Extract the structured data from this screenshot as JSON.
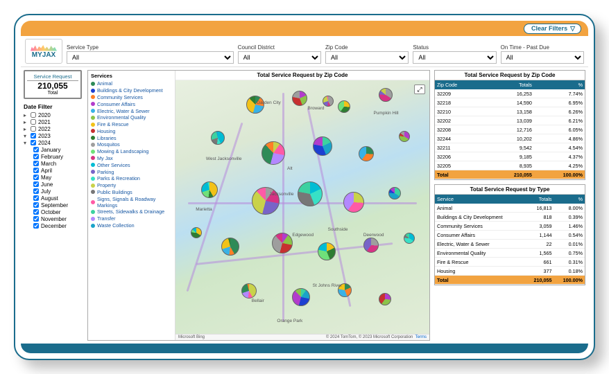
{
  "header": {
    "clear_filters": "Clear Filters",
    "logo_text": "MYJAX"
  },
  "filters": {
    "service_type": {
      "label": "Service Type",
      "value": "All"
    },
    "council_district": {
      "label": "Council District",
      "value": "All"
    },
    "zip_code": {
      "label": "Zip Code",
      "value": "All"
    },
    "status": {
      "label": "Status",
      "value": "All"
    },
    "on_time": {
      "label": "On Time - Past Due",
      "value": "All"
    }
  },
  "metric": {
    "label": "Service Request",
    "value": "210,055",
    "sub": "Total"
  },
  "date_filter": {
    "title": "Date Filter",
    "years": [
      {
        "label": "2020",
        "checked": false
      },
      {
        "label": "2021",
        "checked": false
      },
      {
        "label": "2022",
        "checked": false
      },
      {
        "label": "2023",
        "checked": true
      },
      {
        "label": "2024",
        "checked": true
      }
    ],
    "months": [
      {
        "label": "January",
        "checked": true
      },
      {
        "label": "February",
        "checked": true
      },
      {
        "label": "March",
        "checked": true
      },
      {
        "label": "April",
        "checked": true
      },
      {
        "label": "May",
        "checked": true
      },
      {
        "label": "June",
        "checked": true
      },
      {
        "label": "July",
        "checked": true
      },
      {
        "label": "August",
        "checked": true
      },
      {
        "label": "September",
        "checked": true
      },
      {
        "label": "October",
        "checked": true
      },
      {
        "label": "November",
        "checked": true
      },
      {
        "label": "December",
        "checked": true
      }
    ]
  },
  "legend": {
    "title": "Services",
    "items": [
      {
        "label": "Animal",
        "color": "#2e8b57"
      },
      {
        "label": "Buildings & City Development",
        "color": "#1d3fd1"
      },
      {
        "label": "Community Services",
        "color": "#ff7f27"
      },
      {
        "label": "Consumer Affairs",
        "color": "#b23ccc"
      },
      {
        "label": "Electric, Water & Sewer",
        "color": "#39b2e6"
      },
      {
        "label": "Environmental Quality",
        "color": "#8bc34a"
      },
      {
        "label": "Fire & Rescue",
        "color": "#f2c218"
      },
      {
        "label": "Housing",
        "color": "#c73030"
      },
      {
        "label": "Libraries",
        "color": "#2e7d32"
      },
      {
        "label": "Mosquitos",
        "color": "#9e9e9e"
      },
      {
        "label": "Mowing & Landscaping",
        "color": "#6fe07a"
      },
      {
        "label": "My Jax",
        "color": "#d63384"
      },
      {
        "label": "Other Services",
        "color": "#00bcd4"
      },
      {
        "label": "Parking",
        "color": "#7864c8"
      },
      {
        "label": "Parks & Recreation",
        "color": "#38e0c6"
      },
      {
        "label": "Property",
        "color": "#c9d24a"
      },
      {
        "label": "Public Buildings",
        "color": "#777"
      },
      {
        "label": "Signs, Signals & Roadway Markings",
        "color": "#ff5aa6"
      },
      {
        "label": "Streets, Sidewalks & Drainage",
        "color": "#3dd1a0"
      },
      {
        "label": "Transfer",
        "color": "#b388ff"
      },
      {
        "label": "Waste Collection",
        "color": "#1aa3c9"
      }
    ]
  },
  "map": {
    "title": "Total Service Request by Zip Code",
    "attribution_left": "Microsoft Bing",
    "attribution_right": "© 2024 TomTom, © 2023 Microsoft Corporation",
    "terms": "Terms",
    "places": [
      "Garden City",
      "Jacksonville",
      "Broward",
      "Pumpkin Hill",
      "Bellair",
      "Orange Park",
      "St Johns River",
      "Marietta",
      "Alt",
      "Deerwood",
      "West Jacksonville",
      "Southside",
      "Edgewood"
    ]
  },
  "table_zip": {
    "title": "Total Service Request by Zip Code",
    "cols": [
      "Zip Code",
      "Totals",
      "%"
    ],
    "rows": [
      [
        "32209",
        "16,253",
        "7.74%"
      ],
      [
        "32218",
        "14,590",
        "6.95%"
      ],
      [
        "32210",
        "13,158",
        "6.26%"
      ],
      [
        "32202",
        "13,039",
        "6.21%"
      ],
      [
        "32208",
        "12,716",
        "6.05%"
      ],
      [
        "32244",
        "10,202",
        "4.86%"
      ],
      [
        "32211",
        "9,542",
        "4.54%"
      ],
      [
        "32206",
        "9,185",
        "4.37%"
      ],
      [
        "32205",
        "8,935",
        "4.25%"
      ]
    ],
    "total": [
      "Total",
      "210,055",
      "100.00%"
    ]
  },
  "table_type": {
    "title": "Total Service Request by Type",
    "cols": [
      "Service",
      "Totals",
      "%"
    ],
    "rows": [
      [
        "Animal",
        "16,813",
        "8.00%"
      ],
      [
        "Buildings & City Development",
        "818",
        "0.39%"
      ],
      [
        "Community Services",
        "3,059",
        "1.46%"
      ],
      [
        "Consumer Affairs",
        "1,144",
        "0.54%"
      ],
      [
        "Electric, Water & Sewer",
        "22",
        "0.01%"
      ],
      [
        "Environmental Quality",
        "1,565",
        "0.75%"
      ],
      [
        "Fire & Rescue",
        "661",
        "0.31%"
      ],
      [
        "Housing",
        "377",
        "0.18%"
      ]
    ],
    "total": [
      "Total",
      "210,055",
      "100.00%"
    ]
  },
  "chart_data": {
    "type": "table",
    "title_zip": "Total Service Request by Zip Code",
    "zip": {
      "categories": [
        "32209",
        "32218",
        "32210",
        "32202",
        "32208",
        "32244",
        "32211",
        "32206",
        "32205"
      ],
      "totals": [
        16253,
        14590,
        13158,
        13039,
        12716,
        10202,
        9542,
        9185,
        8935
      ],
      "pct": [
        7.74,
        6.95,
        6.26,
        6.21,
        6.05,
        4.86,
        4.54,
        4.37,
        4.25
      ],
      "grand_total": 210055
    },
    "title_type": "Total Service Request by Type",
    "type_table": {
      "categories": [
        "Animal",
        "Buildings & City Development",
        "Community Services",
        "Consumer Affairs",
        "Electric, Water & Sewer",
        "Environmental Quality",
        "Fire & Rescue",
        "Housing"
      ],
      "totals": [
        16813,
        818,
        3059,
        1144,
        22,
        1565,
        661,
        377
      ],
      "pct": [
        8.0,
        0.39,
        1.46,
        0.54,
        0.01,
        0.75,
        0.31,
        0.18
      ],
      "grand_total": 210055
    }
  }
}
